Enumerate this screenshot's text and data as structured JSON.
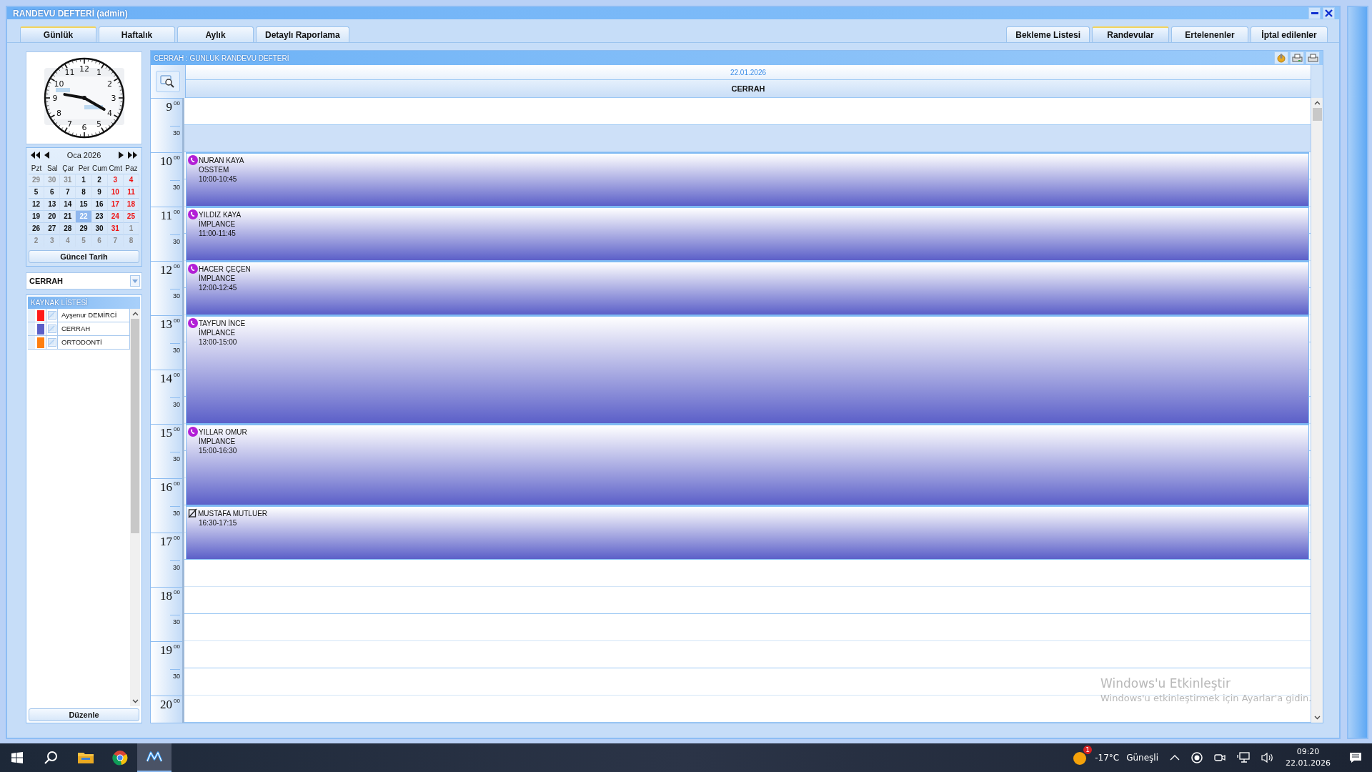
{
  "window": {
    "title": "RANDEVU DEFTERİ (admin)"
  },
  "tabs_left": [
    {
      "label": "Günlük",
      "selected": true
    },
    {
      "label": "Haftalık",
      "selected": false
    },
    {
      "label": "Aylık",
      "selected": false
    },
    {
      "label": "Detaylı Raporlama",
      "selected": false
    }
  ],
  "tabs_right": [
    {
      "label": "Bekleme Listesi",
      "selected": false
    },
    {
      "label": "Randevular",
      "selected": true
    },
    {
      "label": "Ertelenenler",
      "selected": false
    },
    {
      "label": "İptal edilenler",
      "selected": false
    }
  ],
  "clock": {
    "numbers": [
      "11",
      "12",
      "1",
      "10",
      "2",
      "9",
      "3",
      "8",
      "4",
      "7",
      "5",
      "6"
    ]
  },
  "calendar": {
    "month": "Oca 2026",
    "weekdays": [
      "Pzt",
      "Sal",
      "Çar",
      "Per",
      "Cum",
      "Cmt",
      "Paz"
    ],
    "weeks": [
      [
        {
          "day": "29",
          "kind": "other",
          "selected": false
        },
        {
          "day": "30",
          "kind": "other",
          "selected": false
        },
        {
          "day": "31",
          "kind": "other",
          "selected": false
        },
        {
          "day": "1",
          "kind": "normal",
          "selected": false
        },
        {
          "day": "2",
          "kind": "normal",
          "selected": false
        },
        {
          "day": "3",
          "kind": "weekend",
          "selected": false
        },
        {
          "day": "4",
          "kind": "weekend",
          "selected": false
        }
      ],
      [
        {
          "day": "5",
          "kind": "normal",
          "selected": false
        },
        {
          "day": "6",
          "kind": "normal",
          "selected": false
        },
        {
          "day": "7",
          "kind": "normal",
          "selected": false
        },
        {
          "day": "8",
          "kind": "normal",
          "selected": false
        },
        {
          "day": "9",
          "kind": "normal",
          "selected": false
        },
        {
          "day": "10",
          "kind": "weekend",
          "selected": false
        },
        {
          "day": "11",
          "kind": "weekend",
          "selected": false
        }
      ],
      [
        {
          "day": "12",
          "kind": "normal",
          "selected": false
        },
        {
          "day": "13",
          "kind": "normal",
          "selected": false
        },
        {
          "day": "14",
          "kind": "normal",
          "selected": false
        },
        {
          "day": "15",
          "kind": "normal",
          "selected": false
        },
        {
          "day": "16",
          "kind": "normal",
          "selected": false
        },
        {
          "day": "17",
          "kind": "weekend",
          "selected": false
        },
        {
          "day": "18",
          "kind": "weekend",
          "selected": false
        }
      ],
      [
        {
          "day": "19",
          "kind": "normal",
          "selected": false
        },
        {
          "day": "20",
          "kind": "normal",
          "selected": false
        },
        {
          "day": "21",
          "kind": "normal",
          "selected": false
        },
        {
          "day": "22",
          "kind": "normal",
          "selected": true
        },
        {
          "day": "23",
          "kind": "normal",
          "selected": false
        },
        {
          "day": "24",
          "kind": "weekend",
          "selected": false
        },
        {
          "day": "25",
          "kind": "weekend",
          "selected": false
        }
      ],
      [
        {
          "day": "26",
          "kind": "normal",
          "selected": false
        },
        {
          "day": "27",
          "kind": "normal",
          "selected": false
        },
        {
          "day": "28",
          "kind": "normal",
          "selected": false
        },
        {
          "day": "29",
          "kind": "normal",
          "selected": false
        },
        {
          "day": "30",
          "kind": "normal",
          "selected": false
        },
        {
          "day": "31",
          "kind": "weekend",
          "selected": false
        },
        {
          "day": "1",
          "kind": "other",
          "selected": false
        }
      ],
      [
        {
          "day": "2",
          "kind": "other",
          "selected": false
        },
        {
          "day": "3",
          "kind": "other",
          "selected": false
        },
        {
          "day": "4",
          "kind": "other",
          "selected": false
        },
        {
          "day": "5",
          "kind": "other",
          "selected": false
        },
        {
          "day": "6",
          "kind": "other",
          "selected": false
        },
        {
          "day": "7",
          "kind": "other",
          "selected": false
        },
        {
          "day": "8",
          "kind": "other",
          "selected": false
        }
      ]
    ],
    "today_button": "Güncel Tarih"
  },
  "resource_select": {
    "value": "CERRAH"
  },
  "resource_list": {
    "title": "KAYNAK LİSTESİ",
    "items": [
      {
        "name": "Ayşenur DEMİRCİ",
        "color": "#ff1a1a",
        "checked": true
      },
      {
        "name": "CERRAH",
        "color": "#5b5fc7",
        "checked": true
      },
      {
        "name": "ORTODONTİ",
        "color": "#ff7f0f",
        "checked": true
      }
    ],
    "edit_button": "Düzenle"
  },
  "schedule": {
    "title": "CERRAH : GUNLUK RANDEVU DEFTERİ",
    "date": "22.01.2026",
    "resource": "CERRAH",
    "hours": [
      {
        "hour": "9",
        "minutes": [
          "00",
          "30"
        ]
      },
      {
        "hour": "10",
        "minutes": [
          "00",
          "30"
        ]
      },
      {
        "hour": "11",
        "minutes": [
          "00",
          "30"
        ]
      },
      {
        "hour": "12",
        "minutes": [
          "00",
          "30"
        ]
      },
      {
        "hour": "13",
        "minutes": [
          "00",
          "30"
        ]
      },
      {
        "hour": "14",
        "minutes": [
          "00",
          "30"
        ]
      },
      {
        "hour": "15",
        "minutes": [
          "00",
          "30"
        ]
      },
      {
        "hour": "16",
        "minutes": [
          "00",
          "30"
        ]
      },
      {
        "hour": "17",
        "minutes": [
          "00",
          "30"
        ]
      },
      {
        "hour": "18",
        "minutes": [
          "00",
          "30"
        ]
      },
      {
        "hour": "19",
        "minutes": [
          "00",
          "30"
        ]
      },
      {
        "hour": "20",
        "minutes": [
          "00"
        ]
      }
    ],
    "open_slots": [
      {
        "shaded": false
      },
      {
        "shaded": true
      },
      {
        "shaded": false
      },
      {
        "shaded": false
      },
      {
        "shaded": false
      },
      {
        "shaded": false
      },
      {
        "shaded": false
      },
      {
        "shaded": false
      }
    ],
    "appointments": [
      {
        "kind": "phone",
        "name": "NURAN KAYA",
        "detail": "OSSTEM",
        "time": "10:00-10:45"
      },
      {
        "kind": "phone",
        "name": "YILDIZ KAYA",
        "detail": "İMPLANCE",
        "time": "11:00-11:45"
      },
      {
        "kind": "phone",
        "name": "HACER ÇEÇEN",
        "detail": "İMPLANCE",
        "time": "12:00-12:45"
      },
      {
        "kind": "phone",
        "name": "TAYFUN İNCE",
        "detail": "İMPLANCE",
        "time": "13:00-15:00"
      },
      {
        "kind": "phone",
        "name": "YILLAR OMUR",
        "detail": "İMPLANCE",
        "time": "15:00-16:30"
      },
      {
        "kind": "struck",
        "name": "MUSTAFA MUTLUER",
        "time": "16:30-17:15"
      }
    ]
  },
  "activation_notice": {
    "title": "Windows'u Etkinleştir",
    "text": "Windows'u etkinleştirmek için Ayarlar'a gidin."
  },
  "taskbar": {
    "weather": {
      "badge": "1",
      "temperature": "-17°C",
      "condition": "Güneşli"
    },
    "time": "09:20",
    "date": "22.01.2026"
  }
}
